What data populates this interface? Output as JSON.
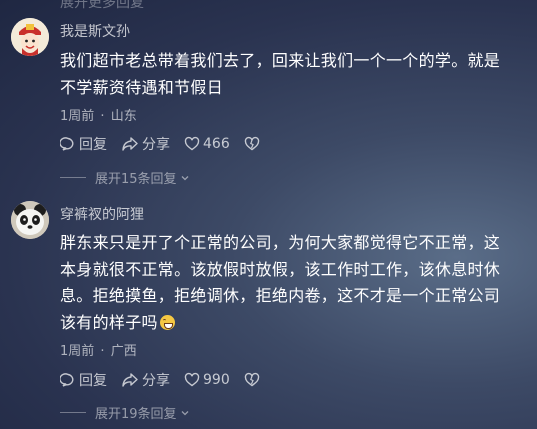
{
  "top_partial_text": "展开更多回复",
  "comments": [
    {
      "username": "我是斯文孙",
      "lines": [
        "我们超市老总带着我们去了，回来让我们一个一个的学。就是",
        "不学薪资待遇和节假日"
      ],
      "time": "1周前",
      "location": "山东",
      "reply_label": "回复",
      "share_label": "分享",
      "likes": "466",
      "replies_label": "展开15条回复"
    },
    {
      "username": "穿裤衩的阿狸",
      "lines": [
        "胖东来只是开了个正常的公司，为何大家都觉得它不正常，这",
        "本身就很不正常。该放假时放假，该工作时工作，该休息时休",
        "息。拒绝摸鱼，拒绝调休，拒绝内卷，这不才是一个正常公司",
        "该有的样子吗"
      ],
      "emoji": "grinning-face",
      "time": "1周前",
      "location": "广西",
      "reply_label": "回复",
      "share_label": "分享",
      "likes": "990",
      "replies_label": "展开19条回复"
    }
  ],
  "separator": "·",
  "colors": {
    "background": "#2a3350",
    "text": "#ffffff",
    "muted": "#a9b0c0"
  }
}
